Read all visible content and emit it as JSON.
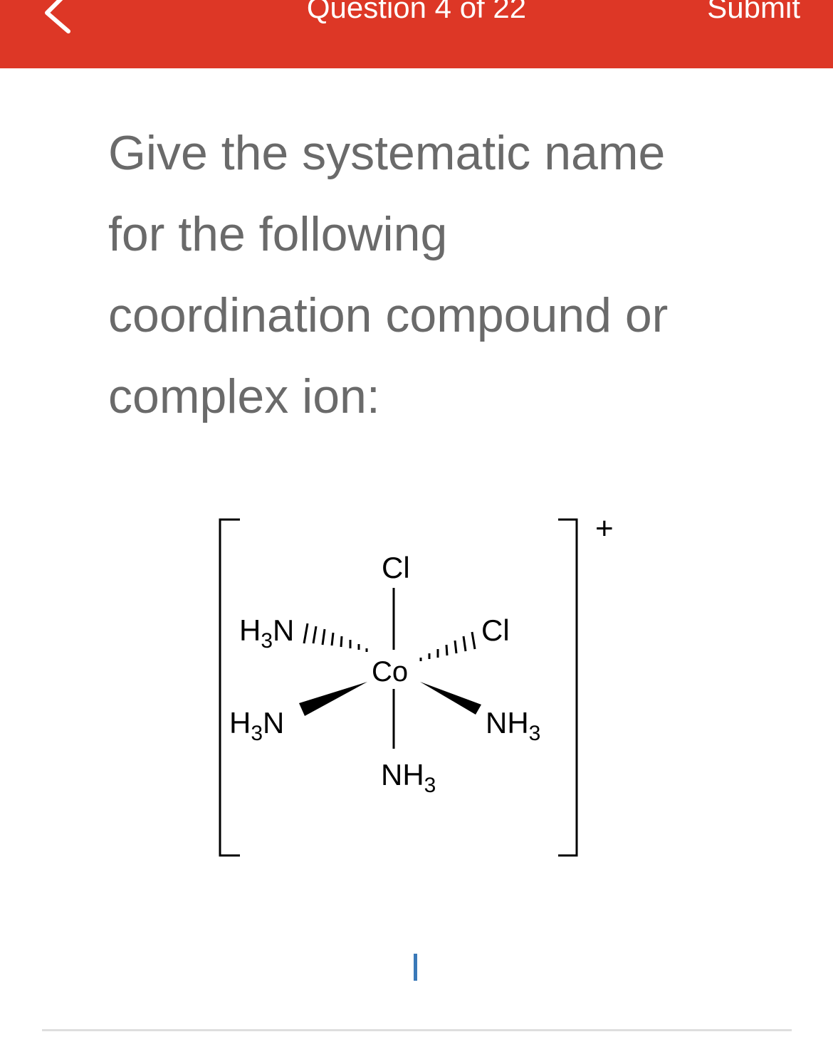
{
  "header": {
    "title": "Question 4 of 22",
    "submit_label": "Submit",
    "background": "#dd3726",
    "back_icon": "chevron-left-icon"
  },
  "question": {
    "lines": [
      "Give the systematic name",
      "for the following",
      "coordination compound or",
      "complex ion:"
    ]
  },
  "structure": {
    "center": "Co",
    "charge": "+",
    "ligands": {
      "top": "Cl",
      "top_right": "Cl",
      "top_left": {
        "main": "H",
        "sub": "3",
        "tail": "N"
      },
      "bottom_left": {
        "main": "H",
        "sub": "3",
        "tail": "N"
      },
      "bottom_right": {
        "main": "NH",
        "sub": "3"
      },
      "bottom": {
        "main": "NH",
        "sub": "3"
      }
    }
  },
  "answer": {
    "value": ""
  }
}
